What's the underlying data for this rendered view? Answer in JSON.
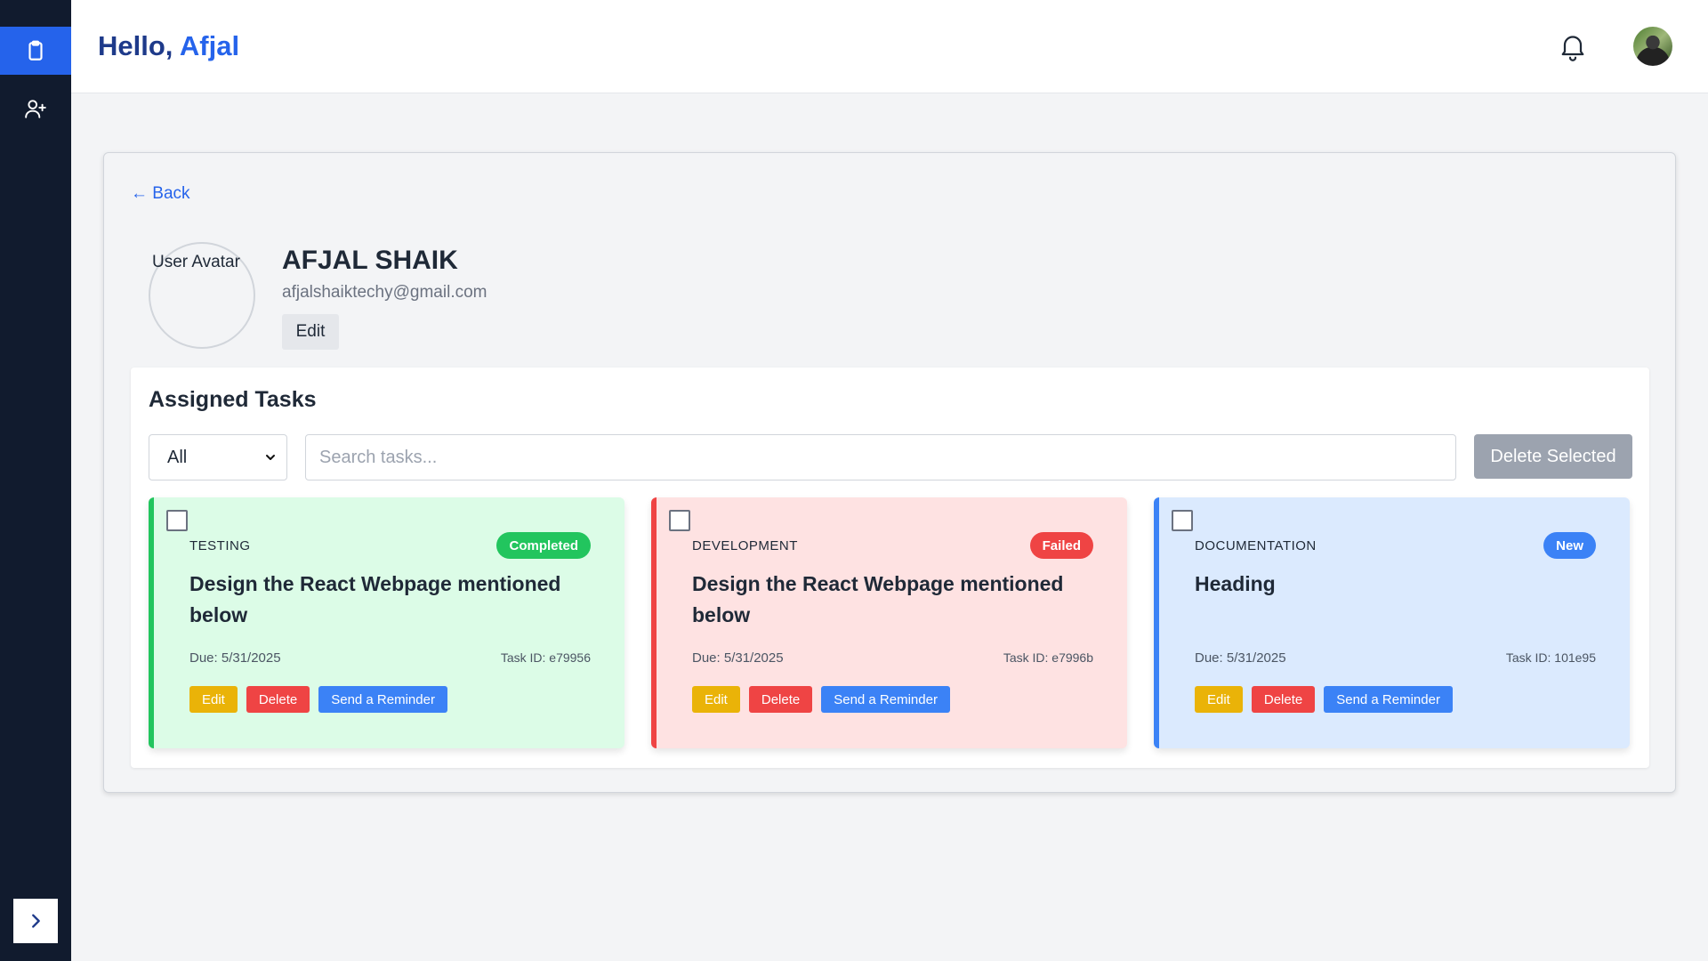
{
  "sidebar": {
    "items": [
      {
        "icon": "clipboard-icon",
        "active": true
      },
      {
        "icon": "user-plus-icon",
        "active": false
      }
    ],
    "toggle_icon": "chevron-right-icon"
  },
  "header": {
    "greeting_prefix": "Hello, ",
    "user_name": "Afjal",
    "bell_icon": "bell-icon"
  },
  "profile": {
    "back_label": "← Back",
    "avatar_alt": "User Avatar",
    "name": "AFJAL SHAIK",
    "email": "afjalshaiktechy@gmail.com",
    "edit_label": "Edit"
  },
  "tasks": {
    "title": "Assigned Tasks",
    "filter_value": "All",
    "search_placeholder": "Search tasks...",
    "delete_selected_label": "Delete Selected",
    "cards": [
      {
        "category": "TESTING",
        "status": "Completed",
        "status_color": "#22c55e",
        "bg_color": "#dcfce7",
        "border_color": "#22c55e",
        "title": "Design the React Webpage mentioned below",
        "due": "Due: 5/31/2025",
        "task_id": "Task ID: e79956",
        "edit_label": "Edit",
        "delete_label": "Delete",
        "reminder_label": "Send a Reminder"
      },
      {
        "category": "DEVELOPMENT",
        "status": "Failed",
        "status_color": "#ef4444",
        "bg_color": "#fee2e2",
        "border_color": "#ef4444",
        "title": "Design the React Webpage mentioned below",
        "due": "Due: 5/31/2025",
        "task_id": "Task ID: e7996b",
        "edit_label": "Edit",
        "delete_label": "Delete",
        "reminder_label": "Send a Reminder"
      },
      {
        "category": "DOCUMENTATION",
        "status": "New",
        "status_color": "#3b82f6",
        "bg_color": "#dbeafe",
        "border_color": "#3b82f6",
        "title": "Heading",
        "due": "Due: 5/31/2025",
        "task_id": "Task ID: 101e95",
        "edit_label": "Edit",
        "delete_label": "Delete",
        "reminder_label": "Send a Reminder"
      }
    ]
  }
}
